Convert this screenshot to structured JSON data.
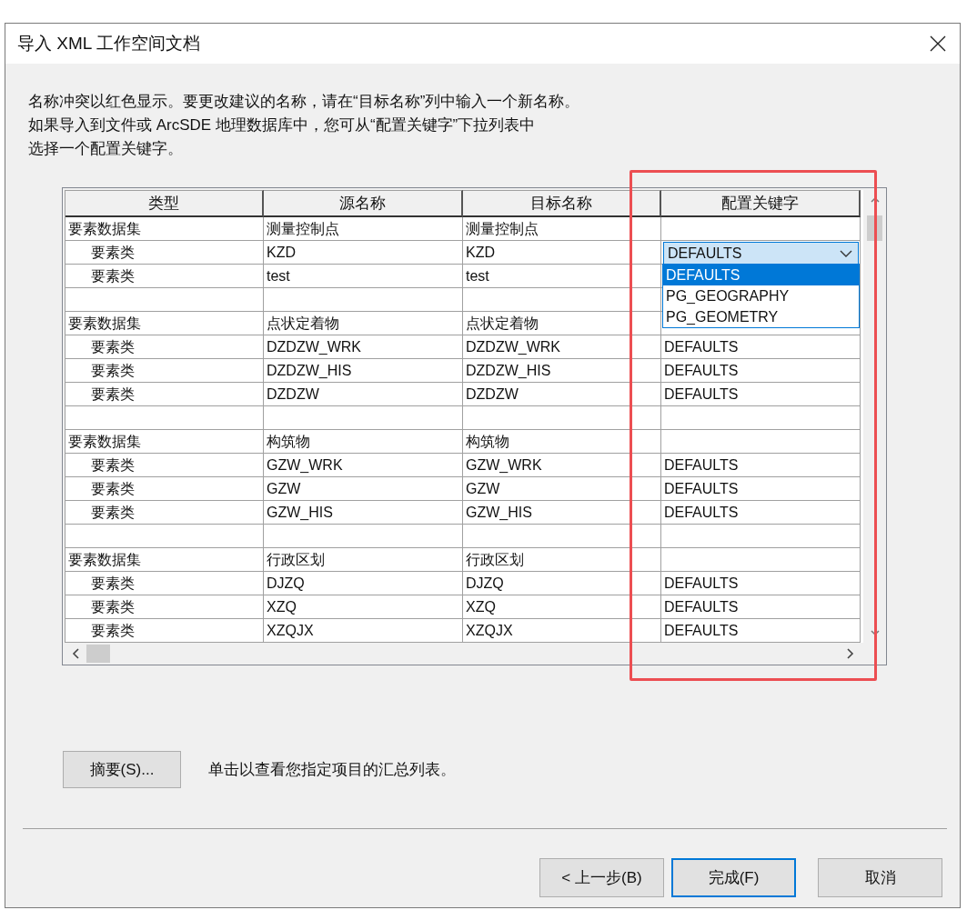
{
  "window": {
    "title": "导入 XML 工作空间文档"
  },
  "instructions": [
    "名称冲突以红色显示。要更改建议的名称，请在“目标名称”列中输入一个新名称。",
    "如果导入到文件或 ArcSDE 地理数据库中，您可从“配置关键字”下拉列表中",
    "选择一个配置关键字。"
  ],
  "table": {
    "columns": [
      "类型",
      "源名称",
      "目标名称",
      "配置关键字"
    ],
    "rows": [
      {
        "kind": "dataset",
        "type": "要素数据集",
        "source": "测量控制点",
        "target": "测量控制点",
        "children": [
          {
            "kind": "class",
            "type": "要素类",
            "source": "KZD",
            "target": "KZD",
            "keyword_dropdown": {
              "value": "DEFAULTS",
              "expanded": true,
              "options": [
                {
                  "label": "DEFAULTS",
                  "selected": true
                },
                {
                  "label": "PG_GEOGRAPHY",
                  "selected": false
                },
                {
                  "label": "PG_GEOMETRY",
                  "selected": false
                }
              ]
            }
          },
          {
            "kind": "class",
            "type": "要素类",
            "source": "test",
            "target": "test"
          }
        ]
      },
      {
        "kind": "blank"
      },
      {
        "kind": "dataset",
        "type": "要素数据集",
        "source": "点状定着物",
        "target": "点状定着物",
        "children": [
          {
            "kind": "class",
            "type": "要素类",
            "source": "DZDZW_WRK",
            "target": "DZDZW_WRK",
            "keyword": "DEFAULTS"
          },
          {
            "kind": "class",
            "type": "要素类",
            "source": "DZDZW_HIS",
            "target": "DZDZW_HIS",
            "keyword": "DEFAULTS"
          },
          {
            "kind": "class",
            "type": "要素类",
            "source": "DZDZW",
            "target": "DZDZW",
            "keyword": "DEFAULTS"
          }
        ]
      },
      {
        "kind": "blank"
      },
      {
        "kind": "dataset",
        "type": "要素数据集",
        "source": "构筑物",
        "target": "构筑物",
        "children": [
          {
            "kind": "class",
            "type": "要素类",
            "source": "GZW_WRK",
            "target": "GZW_WRK",
            "keyword": "DEFAULTS"
          },
          {
            "kind": "class",
            "type": "要素类",
            "source": "GZW",
            "target": "GZW",
            "keyword": "DEFAULTS"
          },
          {
            "kind": "class",
            "type": "要素类",
            "source": "GZW_HIS",
            "target": "GZW_HIS",
            "keyword": "DEFAULTS"
          }
        ]
      },
      {
        "kind": "blank"
      },
      {
        "kind": "dataset",
        "type": "要素数据集",
        "source": "行政区划",
        "target": "行政区划",
        "children": [
          {
            "kind": "class",
            "type": "要素类",
            "source": "DJZQ",
            "target": "DJZQ",
            "keyword": "DEFAULTS"
          },
          {
            "kind": "class",
            "type": "要素类",
            "source": "XZQ",
            "target": "XZQ",
            "keyword": "DEFAULTS"
          },
          {
            "kind": "class",
            "type": "要素类",
            "source": "XZQJX",
            "target": "XZQJX",
            "keyword": "DEFAULTS"
          }
        ]
      }
    ]
  },
  "summary_button": "摘要(S)...",
  "summary_hint": "单击以查看您指定项目的汇总列表。",
  "buttons": [
    {
      "label": "< 上一步(B)",
      "focused": false
    },
    {
      "label": "完成(F)",
      "focused": true
    },
    {
      "label": "取消",
      "focused": false
    }
  ]
}
